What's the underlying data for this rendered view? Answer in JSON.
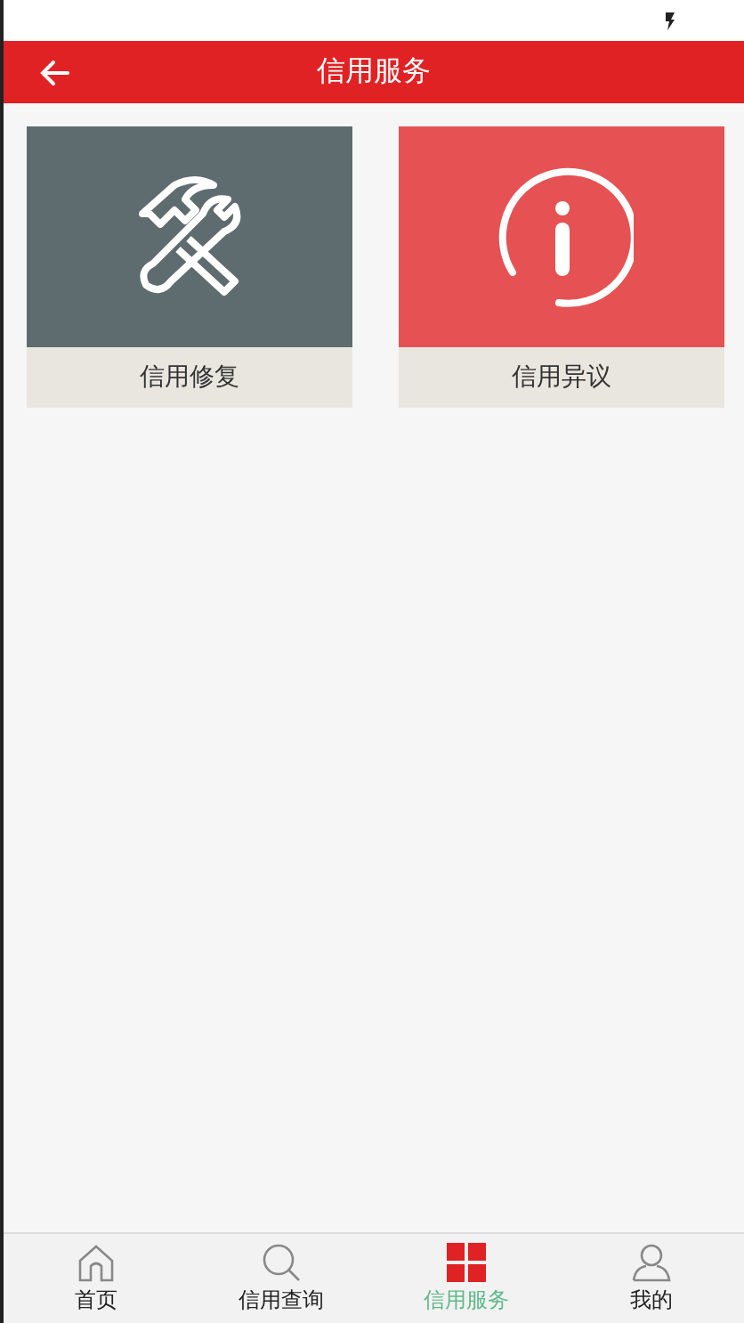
{
  "header": {
    "title": "信用服务"
  },
  "tiles": [
    {
      "label": "信用修复",
      "kind": "repair",
      "color": "#5f6c6f"
    },
    {
      "label": "信用异议",
      "kind": "info",
      "color": "#e65254"
    }
  ],
  "tabbar": [
    {
      "label": "首页",
      "kind": "home",
      "selected": false
    },
    {
      "label": "信用查询",
      "kind": "search",
      "selected": false
    },
    {
      "label": "信用服务",
      "kind": "grid",
      "selected": true
    },
    {
      "label": "我的",
      "kind": "user",
      "selected": false
    }
  ]
}
